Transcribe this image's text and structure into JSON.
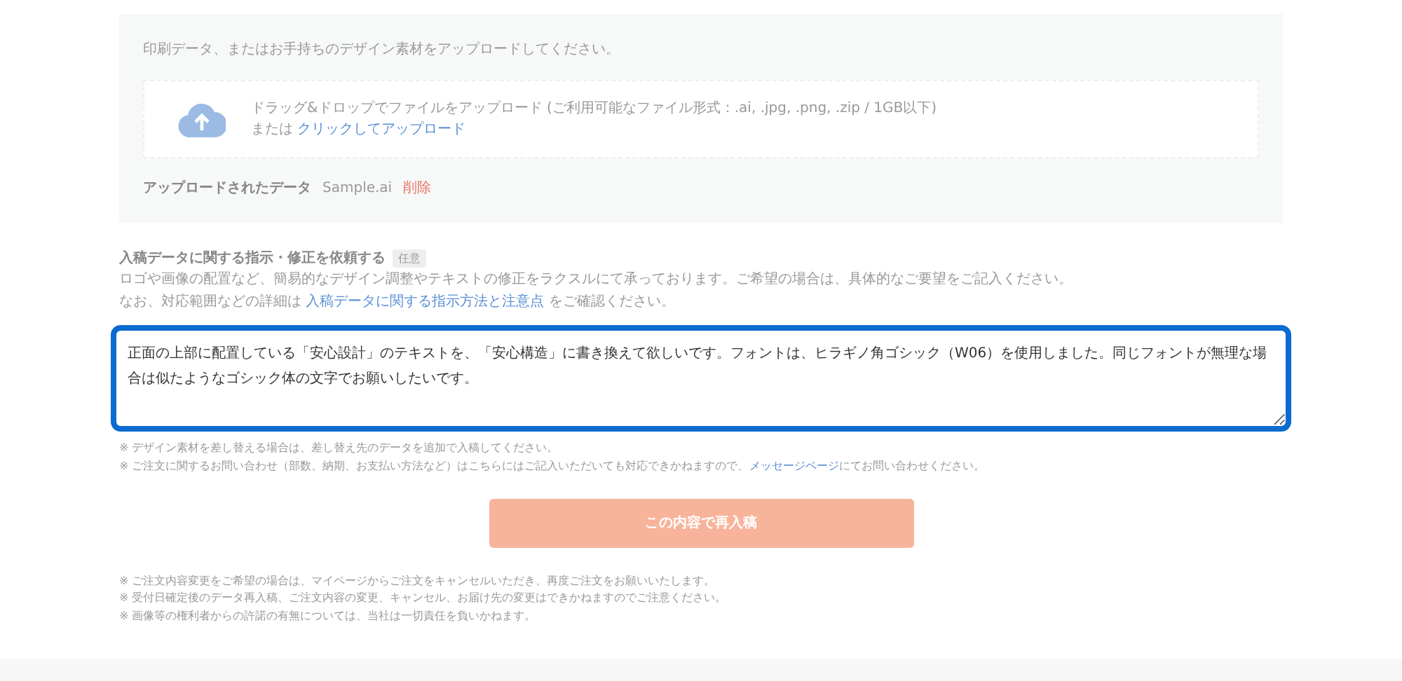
{
  "upload_panel": {
    "intro": "印刷データ、またはお手持ちのデザイン素材をアップロードしてください。",
    "drop_text": "ドラッグ&ドロップでファイルをアップロード (ご利用可能なファイル形式：.ai, .jpg, .png, .zip / 1GB以下)",
    "or_text": "または",
    "click_link": "クリックしてアップロード",
    "uploaded_label": "アップロードされたデータ",
    "file_name": "Sample.ai",
    "delete_link": "削除"
  },
  "instructions": {
    "title": "入稿データに関する指示・修正を依頼する",
    "badge": "任意",
    "description": "ロゴや画像の配置など、簡易的なデザイン調整やテキストの修正をラクスルにて承っております。ご希望の場合は、具体的なご要望をご記入ください。",
    "detail": {
      "before": "なお、対応範囲などの詳細は",
      "link": "入稿データに関する指示方法と注意点",
      "after": "をご確認ください。"
    },
    "textarea": {
      "value": "正面の上部に配置している「安心設計」のテキストを、「安心構造」に書き換えて欲しいです。フォントは、ヒラギノ角ゴシック（W06）を使用しました。同じフォントが無理な場合は似たようなゴシック体の文字でお願いしたいです。",
      "focused": true
    },
    "notes": [
      {
        "before": "※ デザイン素材を差し替える場合は、差し替え先のデータを追加で入稿してください。"
      },
      {
        "before": "※ ご注文に関するお問い合わせ（部数、納期、お支払い方法など）はこちらにはご記入いただいても対応できかねますので、",
        "link": "メッセージページ",
        "after": "にてお問い合わせください。"
      }
    ]
  },
  "submit": {
    "label": "この内容で再入稿",
    "disabled": true
  },
  "footer_notes": [
    "※ ご注文内容変更をご希望の場合は、マイページからご注文をキャンセルいただき、再度ご注文をお願いいたします。",
    "※ 受付日確定後のデータ再入稿、ご注文内容の変更、キャンセル、お届け先の変更はできかねますのでご注意ください。",
    "※ 画像等の権利者からの許諾の有無については、当社は一切責任を負いかねます。"
  ]
}
